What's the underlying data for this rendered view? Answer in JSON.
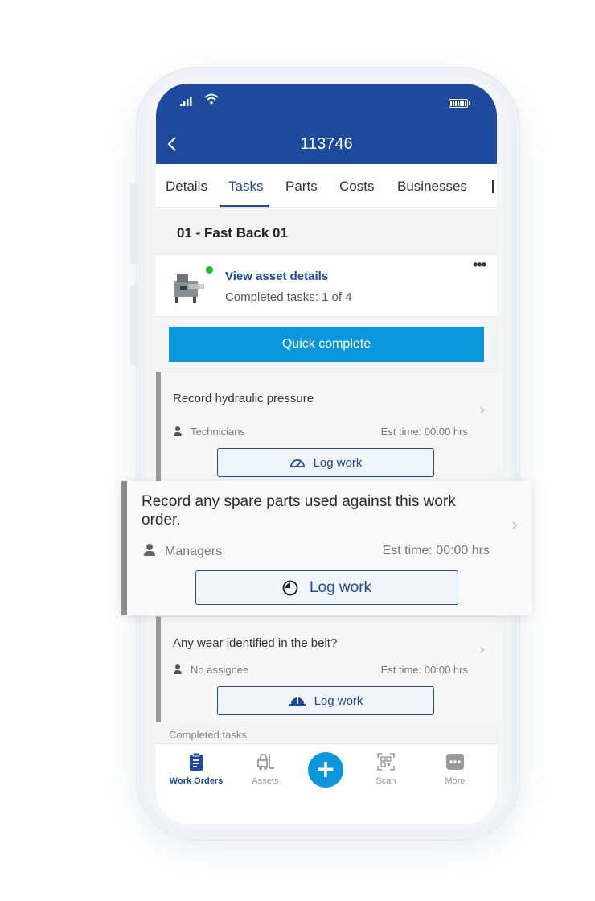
{
  "header": {
    "title": "113746",
    "back_icon": "chevron-left-icon"
  },
  "status_bar": {
    "icons": [
      "signal-icon",
      "wifi-icon",
      "battery-icon"
    ]
  },
  "tabs": [
    {
      "label": "Details",
      "active": false
    },
    {
      "label": "Tasks",
      "active": true
    },
    {
      "label": "Parts",
      "active": false
    },
    {
      "label": "Costs",
      "active": false
    },
    {
      "label": "Businesses",
      "active": false
    }
  ],
  "group": {
    "title": "01 - Fast Back 01"
  },
  "asset": {
    "link": "View asset details",
    "completed": "Completed tasks: 1 of 4",
    "status_color": "#1fbe3a"
  },
  "quick_complete": {
    "label": "Quick complete",
    "color": "#0b96dc"
  },
  "tasks": [
    {
      "title": "Record hydraulic pressure",
      "assignee": "Technicians",
      "est": "Est time: 00:00 hrs",
      "button": "Log work",
      "icon": "gauge-icon"
    },
    {
      "title": "Record any spare parts used against this work order.",
      "assignee": "Managers",
      "est": "Est time: 00:00 hrs",
      "button": "Log work",
      "icon": "pie-timer-icon"
    },
    {
      "title": "Any wear identified in the belt?",
      "assignee": "No assignee",
      "est": "Est time: 00:00 hrs",
      "button": "Log work",
      "icon": "hard-hat-icon"
    }
  ],
  "completed_section": {
    "label": "Completed tasks"
  },
  "bottom_nav": [
    {
      "label": "Work Orders",
      "icon": "clipboard-icon",
      "active": true
    },
    {
      "label": "Assets",
      "icon": "forklift-icon",
      "active": false
    },
    {
      "label": "",
      "icon": "plus-icon",
      "active": false
    },
    {
      "label": "Scan",
      "icon": "qr-scan-icon",
      "active": false
    },
    {
      "label": "More",
      "icon": "more-icon",
      "active": false
    }
  ],
  "colors": {
    "brand": "#1d4a9c",
    "accent": "#0b96dc"
  }
}
